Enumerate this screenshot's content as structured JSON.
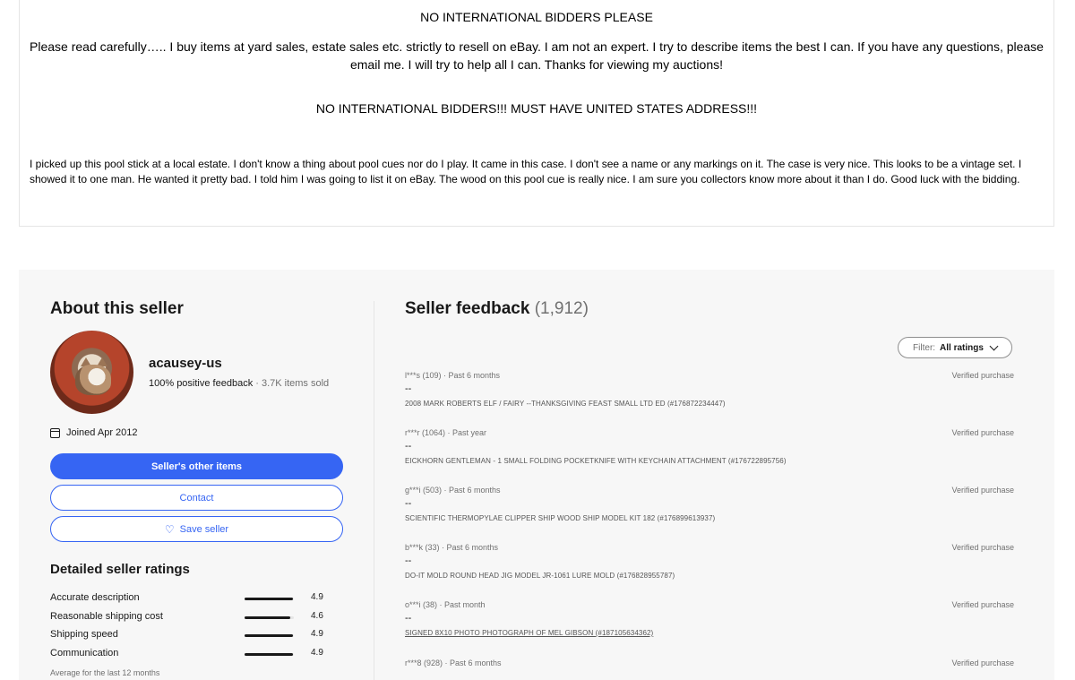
{
  "description": {
    "heading_1": "NO INTERNATIONAL BIDDERS PLEASE",
    "intro": "Please read carefully….. I buy items at yard sales, estate sales etc. strictly to resell on eBay. I am not an expert. I try to describe items the best I can. If you have any questions, please email me. I will try to help all I can. Thanks for viewing my auctions!",
    "heading_2": "NO INTERNATIONAL BIDDERS!!! MUST HAVE UNITED STATES ADDRESS!!!",
    "body": "I picked up this pool stick at a local estate. I don't know a thing about pool cues nor do I play. It came in this case. I don't see a name or any markings on it. The case is very nice. This looks to be a vintage set. I showed it to one man. He wanted it pretty bad. I told him I was going to list it on eBay. The wood on this pool cue is really nice. I am sure you collectors know more about it than I do. Good luck with the bidding."
  },
  "seller": {
    "section_title": "About this seller",
    "name": "acausey-us",
    "positive_feedback": "100% positive feedback",
    "separator": " · ",
    "items_sold": "3.7K items sold",
    "joined": "Joined Apr 2012",
    "other_items_label": "Seller's other items",
    "contact_label": "Contact",
    "save_label": "Save seller",
    "avatar_icon": "cat-photo"
  },
  "ratings": {
    "title": "Detailed seller ratings",
    "items": [
      {
        "label": "Accurate description",
        "value": "4.9",
        "score": 4.9
      },
      {
        "label": "Reasonable shipping cost",
        "value": "4.6",
        "score": 4.6
      },
      {
        "label": "Shipping speed",
        "value": "4.9",
        "score": 4.9
      },
      {
        "label": "Communication",
        "value": "4.9",
        "score": 4.9
      }
    ],
    "max_score": 5,
    "note": "Average for the last 12 months"
  },
  "feedback": {
    "title": "Seller feedback",
    "count": "(1,912)",
    "filter_label": "Filter:",
    "filter_value": "All ratings",
    "items": [
      {
        "user": "l***s (109) · Past 6 months",
        "verified": "Verified purchase",
        "comment": "--",
        "product": "2008 MARK ROBERTS ELF / FAIRY --THANKSGIVING FEAST SMALL LTD ED (#176872234447)",
        "link": false
      },
      {
        "user": "r***r (1064) · Past year",
        "verified": "Verified purchase",
        "comment": "--",
        "product": "EICKHORN GENTLEMAN - 1 SMALL FOLDING POCKETKNIFE WITH KEYCHAIN ATTACHMENT (#176722895756)",
        "link": false
      },
      {
        "user": "g***i (503) · Past 6 months",
        "verified": "Verified purchase",
        "comment": "--",
        "product": "SCIENTIFIC THERMOPYLAE CLIPPER SHIP WOOD SHIP MODEL KIT 182 (#176899613937)",
        "link": false
      },
      {
        "user": "b***k (33) · Past 6 months",
        "verified": "Verified purchase",
        "comment": "--",
        "product": "DO-IT MOLD ROUND HEAD JIG MODEL JR-1061 LURE MOLD (#176828955787)",
        "link": false
      },
      {
        "user": "o***i (38) · Past month",
        "verified": "Verified purchase",
        "comment": "--",
        "product": "SIGNED 8X10 PHOTO PHOTOGRAPH OF MEL GIBSON (#187105634362)",
        "link": true
      },
      {
        "user": "r***8 (928) · Past 6 months",
        "verified": "Verified purchase",
        "comment": "",
        "product": "",
        "link": false
      }
    ]
  },
  "colors": {
    "accent": "#3665f3",
    "section_bg": "#f7f7f7",
    "muted_text": "#707070"
  }
}
